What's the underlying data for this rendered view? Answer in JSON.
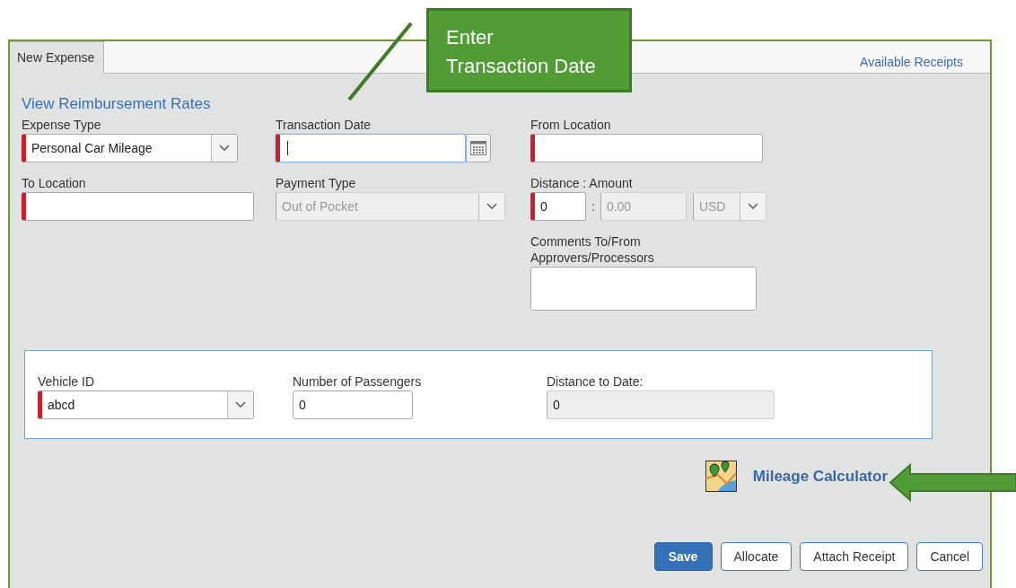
{
  "tabs": [
    {
      "label": "New Expense",
      "selected": true
    }
  ],
  "header_link": "Available Receipts",
  "rates_link": "View Reimbursement Rates",
  "form_columns": [
    {
      "fields": [
        {
          "kind": "select",
          "label": "Expense Type",
          "value": "Personal Car Mileage",
          "required": true,
          "disabled": false
        },
        {
          "kind": "text",
          "label": "To Location",
          "required": true,
          "disabled": false
        }
      ]
    },
    {
      "fields": [
        {
          "kind": "date",
          "label": "Transaction Date",
          "required": true,
          "focused": true
        },
        {
          "kind": "select",
          "label": "Payment Type",
          "value": "Out of Pocket",
          "required": false,
          "disabled": true
        }
      ]
    },
    {
      "fields": [
        {
          "kind": "text",
          "label": "From Location",
          "required": true,
          "disabled": false
        },
        {
          "kind": "distance_amount",
          "label": "Distance : Amount",
          "distance": "0",
          "separator": ":",
          "amount": "0.00",
          "currency": "USD",
          "required": true
        },
        {
          "kind": "textarea",
          "label": "Comments To/From Approvers/Processors",
          "required": false
        }
      ]
    }
  ],
  "vehicle_section": [
    {
      "kind": "select",
      "label": "Vehicle ID",
      "value": "abcd",
      "required": true,
      "disabled": false
    },
    {
      "kind": "text",
      "label": "Number of Passengers",
      "value": "0",
      "required": false,
      "disabled": false
    },
    {
      "kind": "text",
      "label": "Distance to Date:",
      "value": "0",
      "required": false,
      "disabled": true
    }
  ],
  "mileage_calculator": "Mileage Calculator",
  "buttons": [
    {
      "label": "Save",
      "primary": true
    },
    {
      "label": "Allocate",
      "primary": false
    },
    {
      "label": "Attach Receipt",
      "primary": false
    },
    {
      "label": "Cancel",
      "primary": false
    }
  ],
  "callout": [
    "Enter",
    "Transaction Date"
  ]
}
